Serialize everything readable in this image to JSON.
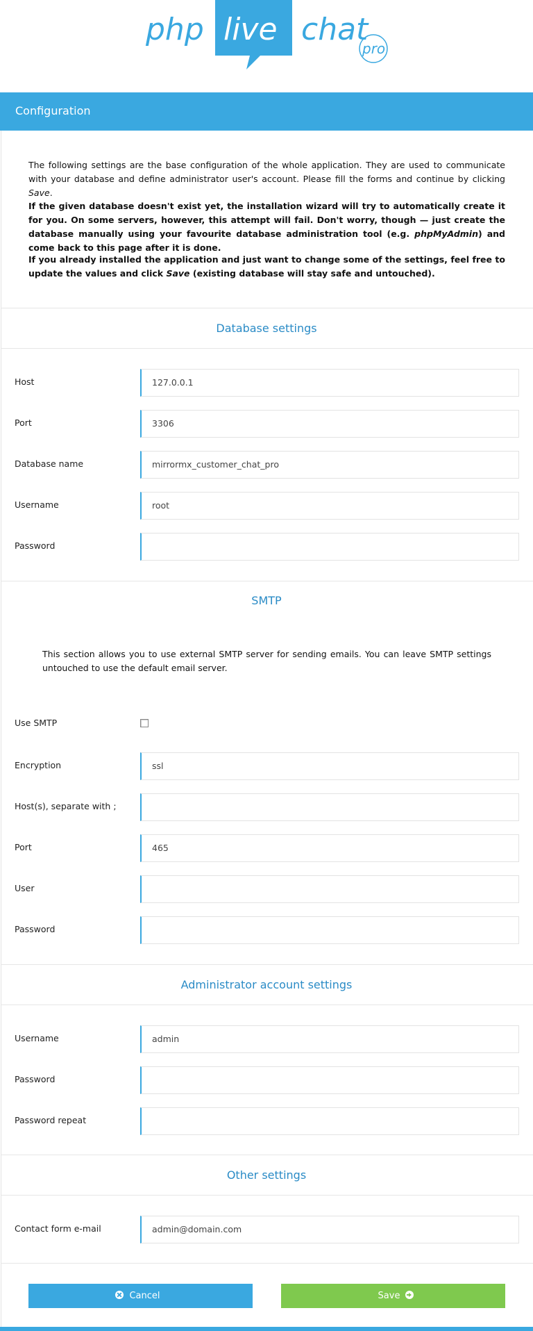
{
  "logo": {
    "word1": "php",
    "word2": "live",
    "word3": "chat",
    "badge": "pro"
  },
  "header": {
    "title": "Configuration"
  },
  "intro": {
    "p1_a": "The following settings are the base configuration of the whole application. They are used to communicate with your database and define administrator user's account. Please fill the forms and continue by clicking ",
    "p1_save": "Save",
    "p1_end": ".",
    "p2_a": "If the given database doesn't exist yet, the installation wizard will try to automatically create it for you. On some servers, however, this attempt will fail. Don't worry, though — just create the database manually using your favourite database administration tool (e.g. ",
    "p2_tool": "phpMyAdmin",
    "p2_end": ") and come back to this page after it is done.",
    "p3_a": "If you already installed the application and just want to change some of the settings, feel free to update the values and click ",
    "p3_save": "Save",
    "p3_end": " (existing database will stay safe and untouched)."
  },
  "database": {
    "title": "Database settings",
    "host_label": "Host",
    "host_value": "127.0.0.1",
    "port_label": "Port",
    "port_value": "3306",
    "dbname_label": "Database name",
    "dbname_value": "mirrormx_customer_chat_pro",
    "username_label": "Username",
    "username_value": "root",
    "password_label": "Password",
    "password_value": ""
  },
  "smtp": {
    "title": "SMTP",
    "note": "This section allows you to use external SMTP server for sending emails. You can leave SMTP settings untouched to use the default email server.",
    "use_label": "Use SMTP",
    "use_checked": false,
    "encryption_label": "Encryption",
    "encryption_value": "ssl",
    "hosts_label": "Host(s), separate with ;",
    "hosts_value": "",
    "port_label": "Port",
    "port_value": "465",
    "user_label": "User",
    "user_value": "",
    "password_label": "Password",
    "password_value": ""
  },
  "admin": {
    "title": "Administrator account settings",
    "username_label": "Username",
    "username_value": "admin",
    "password_label": "Password",
    "password_value": "",
    "password_repeat_label": "Password repeat",
    "password_repeat_value": ""
  },
  "other": {
    "title": "Other settings",
    "contact_label": "Contact form e-mail",
    "contact_value": "admin@domain.com"
  },
  "buttons": {
    "cancel": "Cancel",
    "save": "Save"
  },
  "colors": {
    "accent": "#3aa8e0",
    "title": "#2a8bc6",
    "save": "#7fc94e"
  }
}
